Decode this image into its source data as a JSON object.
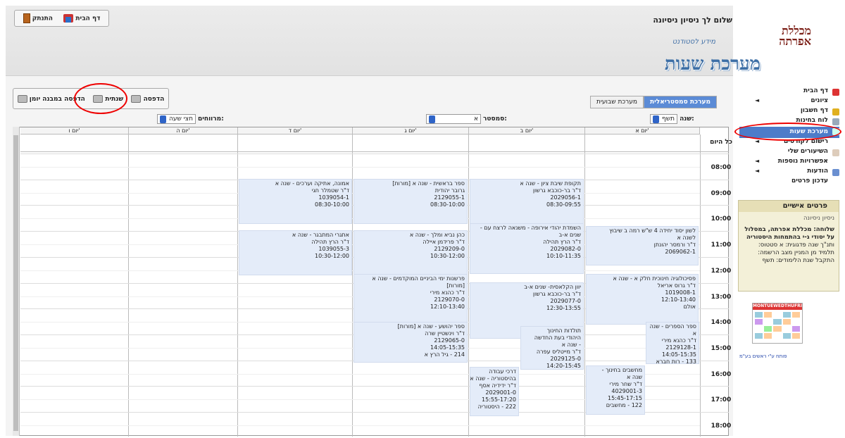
{
  "header": {
    "logout_label": "התנתק",
    "home_label": "דף הבית",
    "welcome": "שלום לך ניסיון ניסיונה",
    "logo_text": "מכללת אפרתה",
    "system_subtitle": "מידע לסטודנט",
    "system_title": "מערכת שעות"
  },
  "sidebar": {
    "items": [
      {
        "label": "דף הבית",
        "arrow": ""
      },
      {
        "label": "ציונים",
        "arrow": "◄"
      },
      {
        "label": "דף חשבון",
        "arrow": ""
      },
      {
        "label": "לוח בחינות",
        "arrow": ""
      },
      {
        "label": "מערכת שעות",
        "arrow": ""
      },
      {
        "label": "רישום לקורסים",
        "arrow": "◄"
      },
      {
        "label": "השיעורים שלי",
        "arrow": ""
      },
      {
        "label": "אפשרויות נוספות",
        "arrow": "◄"
      },
      {
        "label": "הודעות",
        "arrow": "◄"
      },
      {
        "label": "עדכון פרטים",
        "arrow": ""
      }
    ],
    "personal_title": "פרטים אישיים",
    "personal_name": "ניסיון ניסיונה",
    "personal_line1": "שלוחה: מכללת אפרתה, במסלול",
    "personal_line2": "על יסודי ג-י בהתמחות היסטוריה",
    "personal_line3": "ותנ\"ך שנה פדגוגית: א סטטוס:",
    "personal_line4": "תלמיד מן המניין מצב הרשמה:",
    "personal_line5": "התקבל שנת הלימודים: תשף",
    "credit": "פותח ע\"י ראשים בע\"מ"
  },
  "toolbar": {
    "print_label": "הדפסה",
    "annual_label": "שנתית",
    "print_diary_label": "הדפסה במבנה יומן"
  },
  "tabs": {
    "semester": "מערכת סמסטריאלית",
    "weekly": "מערכת שבועית"
  },
  "filters": {
    "year_label": "שנה:",
    "year_value": "תשף",
    "semester_label": "סמסטר:",
    "semester_value": "א",
    "spacing_label": "מרווחים:",
    "spacing_value": "חצי שעה"
  },
  "grid": {
    "days": [
      "יום א'",
      "יום ב'",
      "יום ג'",
      "יום ד'",
      "יום ה'",
      "יום ו'"
    ],
    "all_day": "כל היום",
    "times": [
      "08:00",
      "09:00",
      "10:00",
      "11:00",
      "12:00",
      "13:00",
      "14:00",
      "15:00",
      "16:00",
      "17:00",
      "18:00"
    ]
  },
  "lessons": [
    {
      "lines": [
        "תקופת שיבת ציון - שנה א",
        "ד\"ר בר-כוכבא גרשון",
        "2029056-1",
        "08:30-09:55"
      ]
    },
    {
      "lines": [
        "ספר בראשית - שנה א [מורות]",
        "גרובר יהודית",
        "2129055-1",
        "08:30-10:00"
      ]
    },
    {
      "lines": [
        "אמונה, אתיקה וערכים - שנה א",
        "ד\"ר שטמלר חגי",
        "1039054-1",
        "08:30-10:00"
      ]
    },
    {
      "lines": [
        "השמדת יהודי אירופה - משנאה לרצח עם -",
        "שנים א-ב",
        "ד\"ר הרץ תהילה",
        "2029082-0",
        "10:10-11:35"
      ]
    },
    {
      "lines": [
        "כהן נביא ומלך - שנה א",
        "ד\"ר פרידמן איילה",
        "2129209-0",
        "10:30-12:00"
      ]
    },
    {
      "lines": [
        "אתגרי המתבגר - שנה א",
        "ד\"ר הרץ תהילה",
        "1039055-3",
        "10:30-12:00"
      ]
    },
    {
      "lines": [
        "לשון יסוד יחידה 4 ש\"ש רמה ב שיבוץ",
        "לשנה א",
        "ד\"ר ורמסר יהונתן",
        "2069062-1"
      ]
    },
    {
      "lines": [
        "פרשנות ימי הביניים המוקדמים - שנה א",
        "[מורות]",
        "ד\"ר כהנא מירי",
        "2129070-0",
        "12:10-13:40"
      ]
    },
    {
      "lines": [
        "יוון הקלאסית- שנים א-ב",
        "ד\"ר בר-כוכבא גרשון",
        "2029077-0",
        "12:30-13:55"
      ]
    },
    {
      "lines": [
        "פסיכולוגיה חינוכית חלק א - שנה א",
        "ד\"ר גרוס אריאל",
        "1019008-1",
        "12:10-13:40",
        "אולם"
      ]
    },
    {
      "lines": [
        "ספר יהושע - שנה א [מורות]",
        "ד\"ר וינשטיין שרה",
        "2129065-0",
        "14:05-15:35",
        "214 - גיל הרץ א"
      ]
    },
    {
      "lines": [
        "תולדות החינוך",
        "היהודי בעת החדשה",
        "- שנה א",
        "ד\"ר מייטליס עפרה",
        "2029125-0",
        "14:20-15:45"
      ]
    },
    {
      "lines": [
        "ספר הספרים - שנה",
        "א",
        "ד\"ר כהנא מירי",
        "2129128-1",
        "14:05-15:35",
        "133 - רות חברא"
      ]
    },
    {
      "lines": [
        "דרכי עבודה",
        "בהיסטוריה - שנה א",
        "ד\"ר ידידיה אסף",
        "2029001-0",
        "15:55-17:20",
        "222 - היסטוריה"
      ]
    },
    {
      "lines": [
        "מחשבים בחינוך -",
        "שנה א",
        "ד\"ר שחר מירי",
        "4029001-3",
        "15:45-17:15",
        "122 - מחשבים"
      ]
    }
  ],
  "mini_calendar": {
    "days": [
      "MON",
      "TUE",
      "WED",
      "THU",
      "FRI"
    ]
  }
}
